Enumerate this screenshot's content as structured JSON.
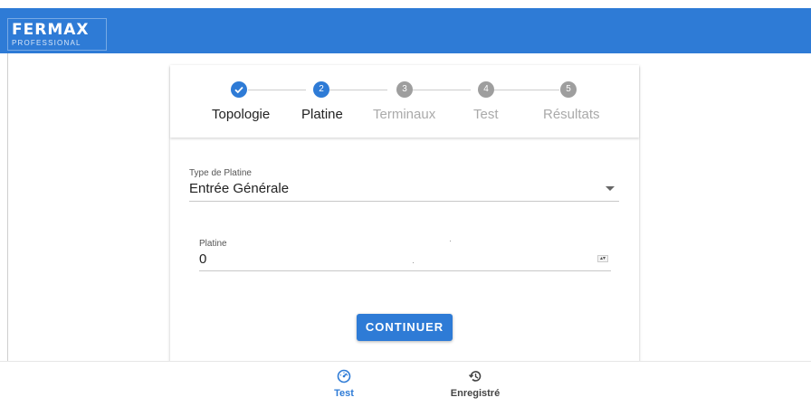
{
  "header": {
    "logo_main": "FERMAX",
    "logo_sub": "PROFESSIONAL",
    "brand_color": "#2e7bd6"
  },
  "stepper": {
    "steps": [
      {
        "number": "",
        "label": "Topologie",
        "state": "done",
        "icon": "check-icon"
      },
      {
        "number": "2",
        "label": "Platine",
        "state": "active"
      },
      {
        "number": "3",
        "label": "Terminaux",
        "state": "pending"
      },
      {
        "number": "4",
        "label": "Test",
        "state": "pending"
      },
      {
        "number": "5",
        "label": "Résultats",
        "state": "pending"
      }
    ]
  },
  "form": {
    "type_platine": {
      "label": "Type de Platine",
      "value": "Entrée Générale"
    },
    "platine": {
      "label": "Platine",
      "value": "0"
    },
    "continue_label": "CONTINUER"
  },
  "bottom_nav": {
    "test": {
      "label": "Test",
      "icon": "speedometer-icon",
      "active": true
    },
    "recorded": {
      "label": "Enregistré",
      "icon": "history-icon",
      "active": false
    }
  }
}
